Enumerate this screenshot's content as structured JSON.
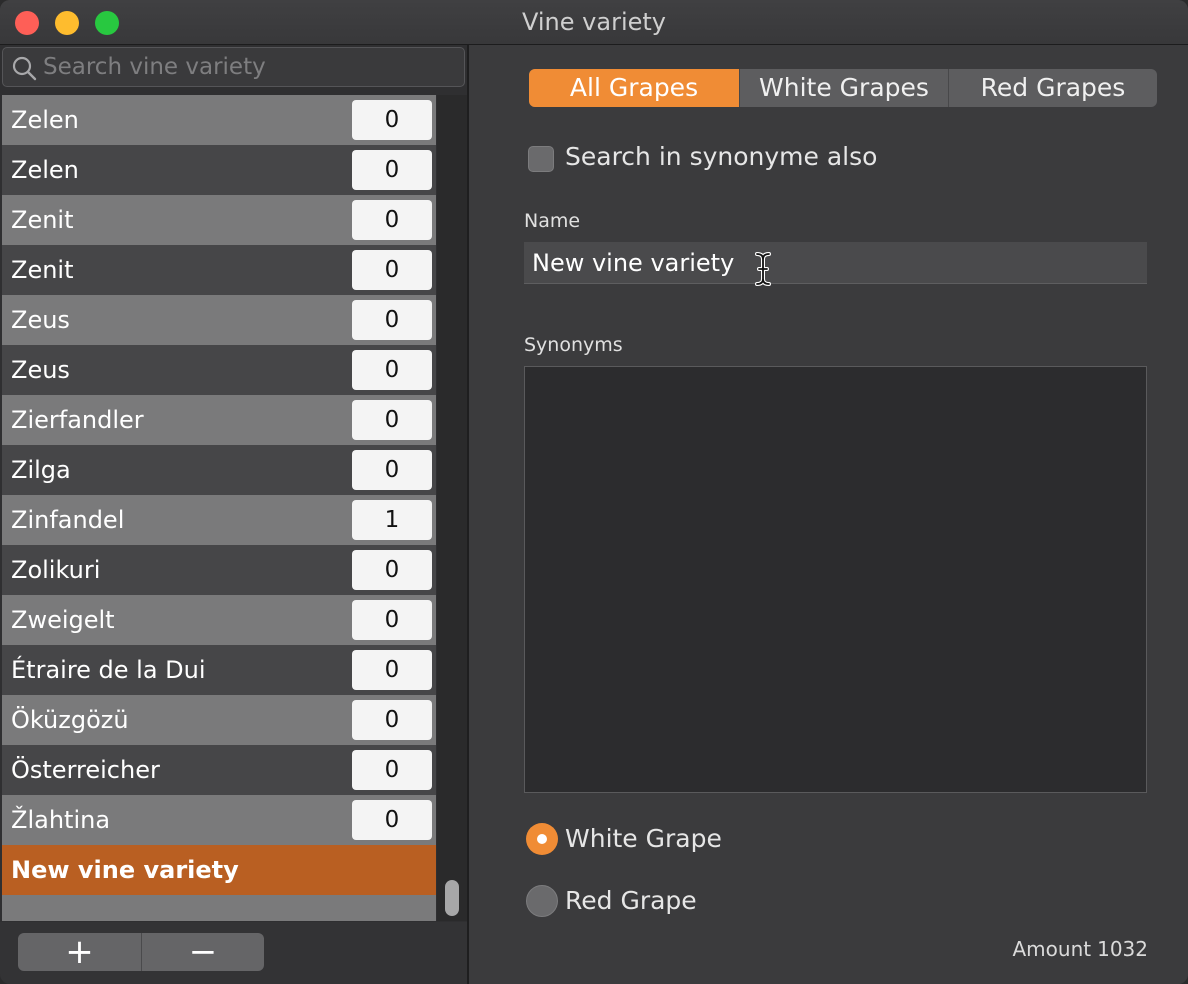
{
  "window": {
    "title": "Vine variety"
  },
  "search": {
    "placeholder": "Search vine variety",
    "value": ""
  },
  "list": {
    "items": [
      {
        "name": "Zelen",
        "count": "0"
      },
      {
        "name": "Zelen",
        "count": "0"
      },
      {
        "name": "Zenit",
        "count": "0"
      },
      {
        "name": "Zenit",
        "count": "0"
      },
      {
        "name": "Zeus",
        "count": "0"
      },
      {
        "name": "Zeus",
        "count": "0"
      },
      {
        "name": "Zierfandler",
        "count": "0"
      },
      {
        "name": "Zilga",
        "count": "0"
      },
      {
        "name": "Zinfandel",
        "count": "1"
      },
      {
        "name": "Zolikuri",
        "count": "0"
      },
      {
        "name": "Zweigelt",
        "count": "0"
      },
      {
        "name": "Étraire de la Dui",
        "count": "0"
      },
      {
        "name": "Öküzgözü",
        "count": "0"
      },
      {
        "name": "Österreicher",
        "count": "0"
      },
      {
        "name": "Žlahtina",
        "count": "0"
      }
    ],
    "selected_item": {
      "name": "New vine variety"
    }
  },
  "footer": {
    "add_label": "+",
    "remove_label": "−"
  },
  "filter": {
    "tabs": [
      {
        "label": "All Grapes",
        "active": true
      },
      {
        "label": "White Grapes",
        "active": false
      },
      {
        "label": "Red Grapes",
        "active": false
      }
    ]
  },
  "options": {
    "synonym_search_label": "Search in synonyme also",
    "synonym_search_checked": false
  },
  "form": {
    "name_label": "Name",
    "name_value": "New vine variety",
    "synonyms_label": "Synonyms",
    "synonyms_value": "",
    "color_options": [
      {
        "label": "White Grape",
        "selected": true
      },
      {
        "label": "Red Grape",
        "selected": false
      }
    ]
  },
  "status": {
    "amount_label": "Amount",
    "amount_value": "1032"
  },
  "colors": {
    "accent": "#f08c35",
    "selected_row": "#b95f22"
  }
}
